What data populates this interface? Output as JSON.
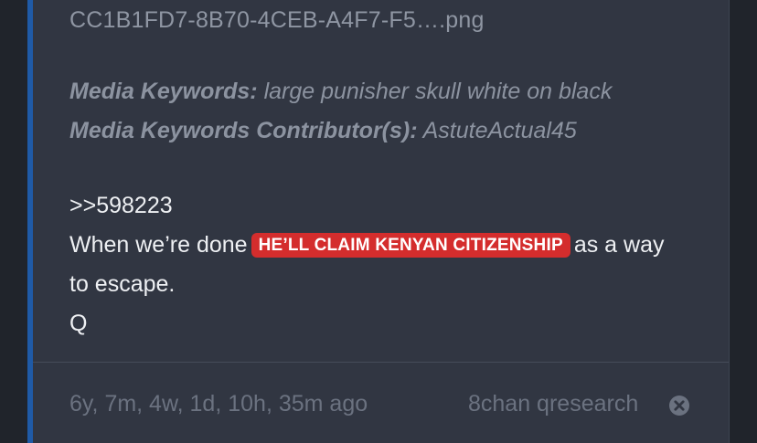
{
  "attachment": {
    "filename": "CC1B1FD7-8B70-4CEB-A4F7-F5….png"
  },
  "media": {
    "keywords_label": "Media Keywords:",
    "keywords_value": "large punisher skull white on black",
    "contributors_label": "Media Keywords Contributor(s):",
    "contributors_value": "AstuteActual45"
  },
  "post": {
    "reference": ">>598223",
    "text_before": "When we’re done",
    "highlight": "HE’LL CLAIM KENYAN CITIZENSHIP",
    "text_after": "as a way",
    "line3": "to escape.",
    "signature": "Q"
  },
  "footer": {
    "timestamp": "6y, 7m, 4w, 1d, 10h, 35m ago",
    "source": "8chan qresearch",
    "close_icon": "close-circle-icon"
  },
  "colors": {
    "accent": "#1f5aa6",
    "highlight": "#d42d2d",
    "card": "#313642",
    "background": "#20242b"
  }
}
